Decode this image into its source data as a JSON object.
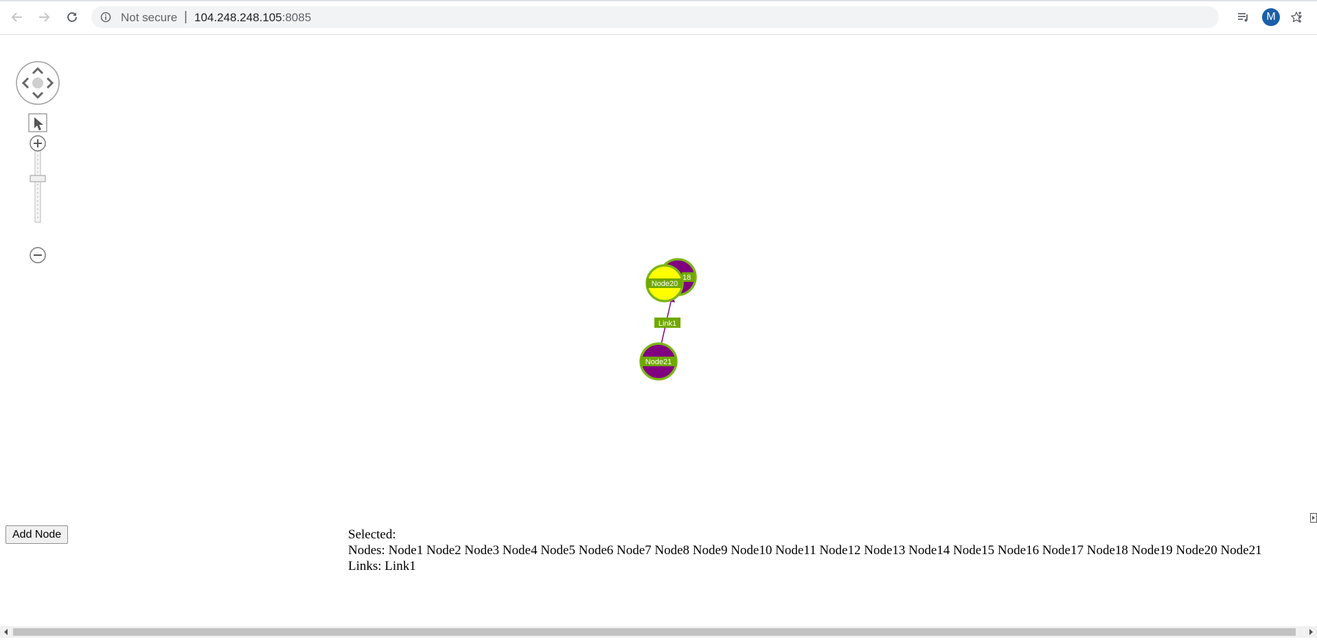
{
  "browser": {
    "security_label": "Not secure",
    "separator": "|",
    "url_host": "104.248.248.105",
    "url_port": ":8085",
    "profile_initial": "M",
    "accent": "#1a5fa8"
  },
  "navigator": {
    "pan_icon": "pan-arrows-icon",
    "select_icon": "pointer-icon",
    "zoom_in_icon": "plus-icon",
    "zoom_out_icon": "minus-icon",
    "zoom_level_fraction": 0.6
  },
  "graph": {
    "node_fill": "#800080",
    "node_selected_fill": "#ffff00",
    "node_stroke": "#7cb518",
    "label_bg": "#70a800",
    "nodes": [
      {
        "id": "back-node",
        "label": "Node18"
      },
      {
        "id": "node20",
        "label": "Node20"
      },
      {
        "id": "node21",
        "label": "Node21"
      }
    ],
    "links": [
      {
        "label": "Link1",
        "from": "Node21",
        "to": "Node20"
      }
    ]
  },
  "controls": {
    "add_node_label": "Add Node"
  },
  "selection": {
    "heading": "Selected:",
    "nodes_line": "Nodes: Node1 Node2 Node3 Node4 Node5 Node6 Node7 Node8 Node9 Node10 Node11 Node12 Node13 Node14 Node15 Node16 Node17 Node18 Node19 Node20 Node21",
    "links_line": "Links: Link1"
  }
}
